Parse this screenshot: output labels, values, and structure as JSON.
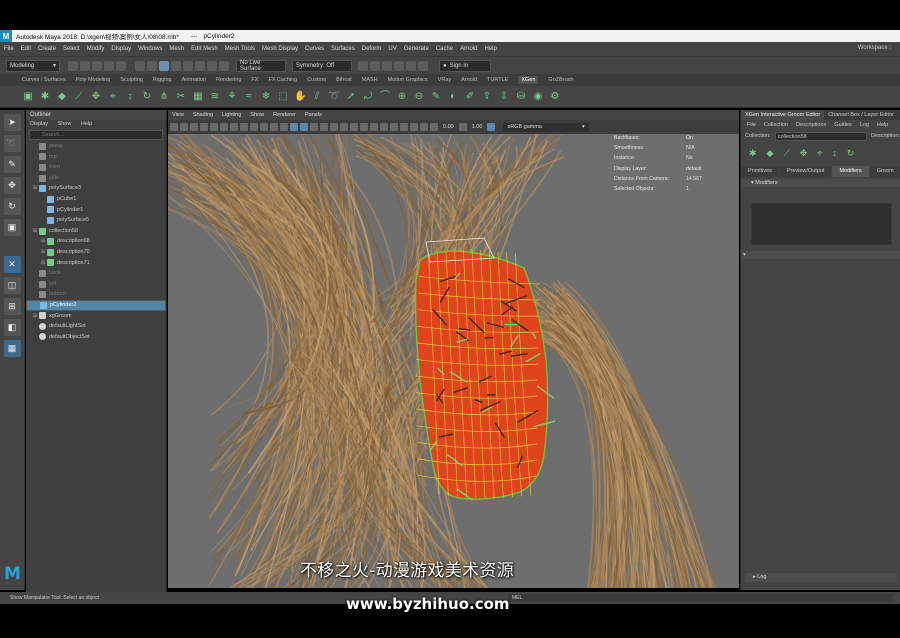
{
  "window": {
    "app_icon": "maya-logo-icon",
    "title": "Autodesk Maya 2018: D:\\xgen\\视频\\案例\\女人\\08\\08.mb*",
    "separator": "---",
    "selected_object": "pCylinder2"
  },
  "menubar": {
    "items": [
      "File",
      "Edit",
      "Create",
      "Select",
      "Modify",
      "Display",
      "Windows",
      "Mesh",
      "Edit Mesh",
      "Mesh Tools",
      "Mesh Display",
      "Curves",
      "Surfaces",
      "Deform",
      "UV",
      "Generate",
      "Cache",
      "Arnold",
      "Help"
    ],
    "workspace": "Workspace :"
  },
  "statusline": {
    "mode": "Modeling",
    "live_surface": "No Live Surface",
    "symmetry": "Symmetry: Off",
    "signin": "Sign In"
  },
  "shelf_tabs": {
    "items": [
      "Curves / Surfaces",
      "Poly Modeling",
      "Sculpting",
      "Rigging",
      "Animation",
      "Rendering",
      "FX",
      "FX Caching",
      "Custom",
      "Bifrost",
      "MASH",
      "Motion Graphics",
      "VRay",
      "Arnold",
      "TURTLE",
      "XGen",
      "GoZBrush"
    ],
    "active": "XGen"
  },
  "outliner": {
    "title": "Outliner",
    "menu": [
      "Display",
      "Show",
      "Help"
    ],
    "search_placeholder": "Search...",
    "items": [
      {
        "label": "persp",
        "dim": true,
        "indent": 0,
        "icon": "camera-icon"
      },
      {
        "label": "top",
        "dim": true,
        "indent": 0,
        "icon": "camera-icon"
      },
      {
        "label": "front",
        "dim": true,
        "indent": 0,
        "icon": "camera-icon"
      },
      {
        "label": "side",
        "dim": true,
        "indent": 0,
        "icon": "camera-icon"
      },
      {
        "label": "polySurface3",
        "dim": false,
        "indent": 0,
        "icon": "mesh-icon",
        "plus": true
      },
      {
        "label": "pCube1",
        "dim": false,
        "indent": 1,
        "icon": "mesh-icon"
      },
      {
        "label": "pCylinder1",
        "dim": false,
        "indent": 1,
        "icon": "mesh-icon"
      },
      {
        "label": "polySurface5",
        "dim": false,
        "indent": 1,
        "icon": "mesh-icon"
      },
      {
        "label": "collection58",
        "dim": false,
        "indent": 0,
        "icon": "xgen-collection-icon",
        "plus": true
      },
      {
        "label": "description68",
        "dim": false,
        "indent": 1,
        "icon": "xgen-description-icon",
        "plus": true
      },
      {
        "label": "description70",
        "dim": false,
        "indent": 1,
        "icon": "xgen-description-icon",
        "plus": true
      },
      {
        "label": "description71",
        "dim": false,
        "indent": 1,
        "icon": "xgen-description-icon",
        "plus": true
      },
      {
        "label": "back",
        "dim": true,
        "indent": 0,
        "icon": "camera-icon"
      },
      {
        "label": "left",
        "dim": true,
        "indent": 0,
        "icon": "camera-icon"
      },
      {
        "label": "bottom",
        "dim": true,
        "indent": 0,
        "icon": "camera-icon"
      },
      {
        "label": "pCylinder2",
        "dim": false,
        "indent": 0,
        "icon": "mesh-icon",
        "selected": true
      },
      {
        "label": "xgGroom",
        "dim": false,
        "indent": 0,
        "icon": "group-icon",
        "plus": true
      },
      {
        "label": "defaultLightSet",
        "dim": false,
        "indent": 0,
        "icon": "set-icon"
      },
      {
        "label": "defaultObjectSet",
        "dim": false,
        "indent": 0,
        "icon": "set-icon"
      }
    ]
  },
  "viewport": {
    "menu": [
      "View",
      "Shading",
      "Lighting",
      "Show",
      "Renderer",
      "Panels"
    ],
    "exposure": "0.00",
    "gamma": "1.00",
    "color_space": "sRGB gamma",
    "hud": [
      {
        "key": "Backfaces:",
        "value": "On"
      },
      {
        "key": "Smoothness:",
        "value": "N/A"
      },
      {
        "key": "Instance:",
        "value": "No"
      },
      {
        "key": "Display Layer:",
        "value": "default"
      },
      {
        "key": "Distance From Camera:",
        "value": "14.567"
      },
      {
        "key": "Selected Objects:",
        "value": "1"
      }
    ],
    "colors": {
      "background": "#6e6e6e",
      "hair": "#a8865c",
      "mesh": "#e0441c",
      "wire": "#f2d23a"
    }
  },
  "xgen": {
    "tabs": [
      "XGen Interactive Groom Editor",
      "Channel Box / Layer Editor"
    ],
    "menu": [
      "File",
      "Collection",
      "Descriptions",
      "Guides",
      "Log",
      "Help"
    ],
    "collection_label": "Collection:",
    "collection_value": "collection58",
    "description_label": "Description:",
    "subtabs": [
      "Primitives",
      "Preview/Output",
      "Modifiers",
      "Groom"
    ],
    "active_subtab": "Modifiers",
    "modifiers_header": "Modifiers",
    "log_header": "Log"
  },
  "helpline": {
    "text": "Show Manipulator Tool: Select an object",
    "mel": "MEL"
  },
  "watermark": {
    "logo": "M",
    "subtitle": "不移之火-动漫游戏美术资源",
    "url": "www.byzhihuo.com"
  }
}
